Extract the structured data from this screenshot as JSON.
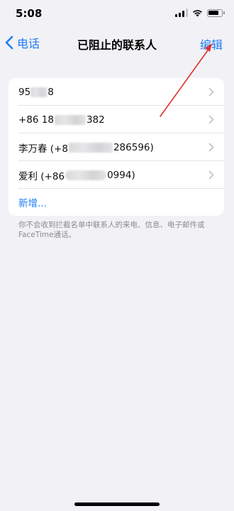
{
  "status": {
    "time": "5:08"
  },
  "nav": {
    "back_label": "电话",
    "title": "已阻止的联系人",
    "edit_label": "编辑"
  },
  "contacts": [
    {
      "pre": "95",
      "post": "8"
    },
    {
      "pre": "+86 18",
      "post": "382"
    },
    {
      "pre": "李万春 (+8",
      "post": "286596)"
    },
    {
      "pre": "爱利 (+86",
      "post": "0994)"
    }
  ],
  "add_label": "新增...",
  "note": "你不会收到拦截名单中联系人的来电、信息、电子邮件或FaceTime通话。",
  "colors": {
    "accent": "#1f7cf5",
    "annotation": "#e0302a"
  }
}
